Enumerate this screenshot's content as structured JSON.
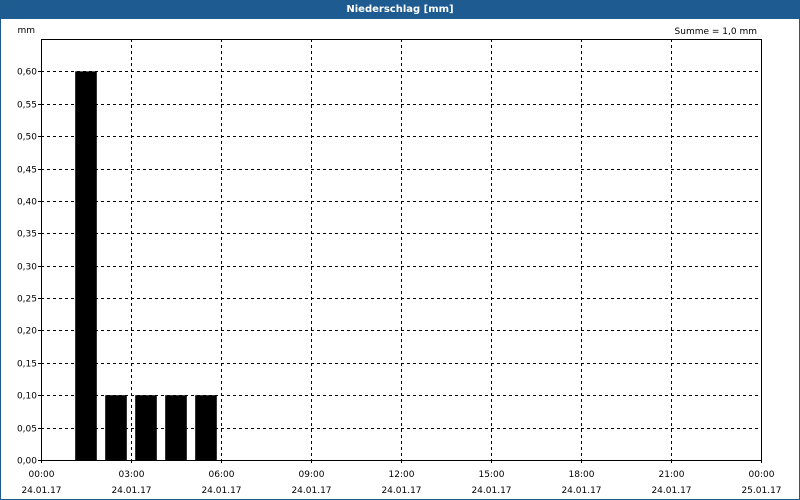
{
  "window": {
    "title": "Niederschlag [mm]"
  },
  "chart_data": {
    "type": "bar",
    "title": "Niederschlag [mm]",
    "ylabel": "mm",
    "xlabel": "",
    "annotation": "Summe = 1,0 mm",
    "ylim": [
      0,
      0.65
    ],
    "xlim_hours": [
      0,
      24
    ],
    "yticks": [
      {
        "value": 0.0,
        "label": "0,00"
      },
      {
        "value": 0.05,
        "label": "0,05"
      },
      {
        "value": 0.1,
        "label": "0,10"
      },
      {
        "value": 0.15,
        "label": "0,15"
      },
      {
        "value": 0.2,
        "label": "0,20"
      },
      {
        "value": 0.25,
        "label": "0,25"
      },
      {
        "value": 0.3,
        "label": "0,30"
      },
      {
        "value": 0.35,
        "label": "0,35"
      },
      {
        "value": 0.4,
        "label": "0,40"
      },
      {
        "value": 0.45,
        "label": "0,45"
      },
      {
        "value": 0.5,
        "label": "0,50"
      },
      {
        "value": 0.55,
        "label": "0,55"
      },
      {
        "value": 0.6,
        "label": "0,60"
      }
    ],
    "xticks": [
      {
        "hour": 0,
        "time": "00:00",
        "date": "24.01.17"
      },
      {
        "hour": 3,
        "time": "03:00",
        "date": "24.01.17"
      },
      {
        "hour": 6,
        "time": "06:00",
        "date": "24.01.17"
      },
      {
        "hour": 9,
        "time": "09:00",
        "date": "24.01.17"
      },
      {
        "hour": 12,
        "time": "12:00",
        "date": "24.01.17"
      },
      {
        "hour": 15,
        "time": "15:00",
        "date": "24.01.17"
      },
      {
        "hour": 18,
        "time": "18:00",
        "date": "24.01.17"
      },
      {
        "hour": 21,
        "time": "21:00",
        "date": "24.01.17"
      },
      {
        "hour": 24,
        "time": "00:00",
        "date": "25.01.17"
      }
    ],
    "bars": [
      {
        "start_hour": 1,
        "end_hour": 2,
        "value": 0.6
      },
      {
        "start_hour": 2,
        "end_hour": 3,
        "value": 0.1
      },
      {
        "start_hour": 3,
        "end_hour": 4,
        "value": 0.1
      },
      {
        "start_hour": 4,
        "end_hour": 5,
        "value": 0.1
      },
      {
        "start_hour": 5,
        "end_hour": 6,
        "value": 0.1
      }
    ],
    "grid": true,
    "colors": {
      "bar": "#000000",
      "titlebar": "#1e5b91",
      "grid": "#000000"
    }
  }
}
